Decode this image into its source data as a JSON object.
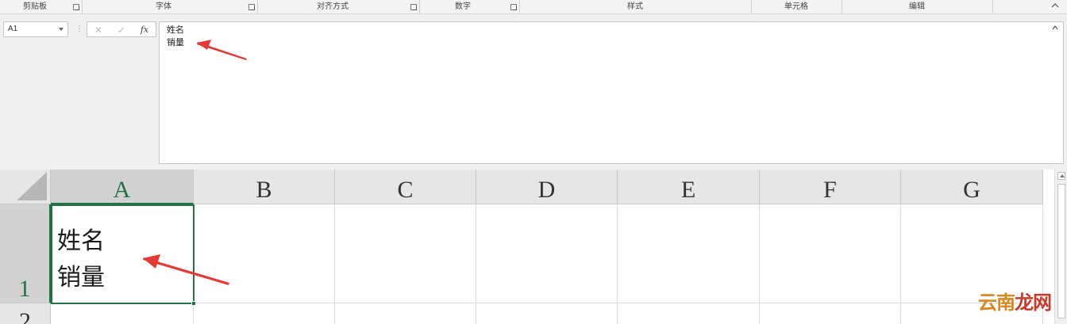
{
  "ribbon": {
    "groups": [
      {
        "label": "剪贴板"
      },
      {
        "label": "字体"
      },
      {
        "label": "对齐方式"
      },
      {
        "label": "数字"
      },
      {
        "label": "样式"
      },
      {
        "label": "单元格"
      },
      {
        "label": "编辑"
      }
    ]
  },
  "formula_bar": {
    "name_box": "A1",
    "cancel_icon": "✕",
    "enter_icon": "✓",
    "fx_label": "fx",
    "content_lines": [
      "姓名",
      "销量"
    ]
  },
  "sheet": {
    "columns": [
      "A",
      "B",
      "C",
      "D",
      "E",
      "F",
      "G"
    ],
    "rows": [
      "1",
      "2"
    ],
    "active_cell": "A1",
    "cells": {
      "A1": {
        "lines": [
          "姓名",
          "销量"
        ]
      }
    }
  },
  "watermark": {
    "prefix": "云南",
    "suffix": "龙网"
  },
  "colors": {
    "accent": "#217346",
    "annotation_arrow": "#e53935",
    "header_bg": "#e6e6e6"
  },
  "icons": [
    "dialog-launcher-icon",
    "collapse-ribbon-icon",
    "dropdown-caret-icon",
    "cancel-icon",
    "enter-icon",
    "function-icon",
    "collapse-formula-bar-icon",
    "select-all-icon",
    "scroll-up-icon"
  ]
}
